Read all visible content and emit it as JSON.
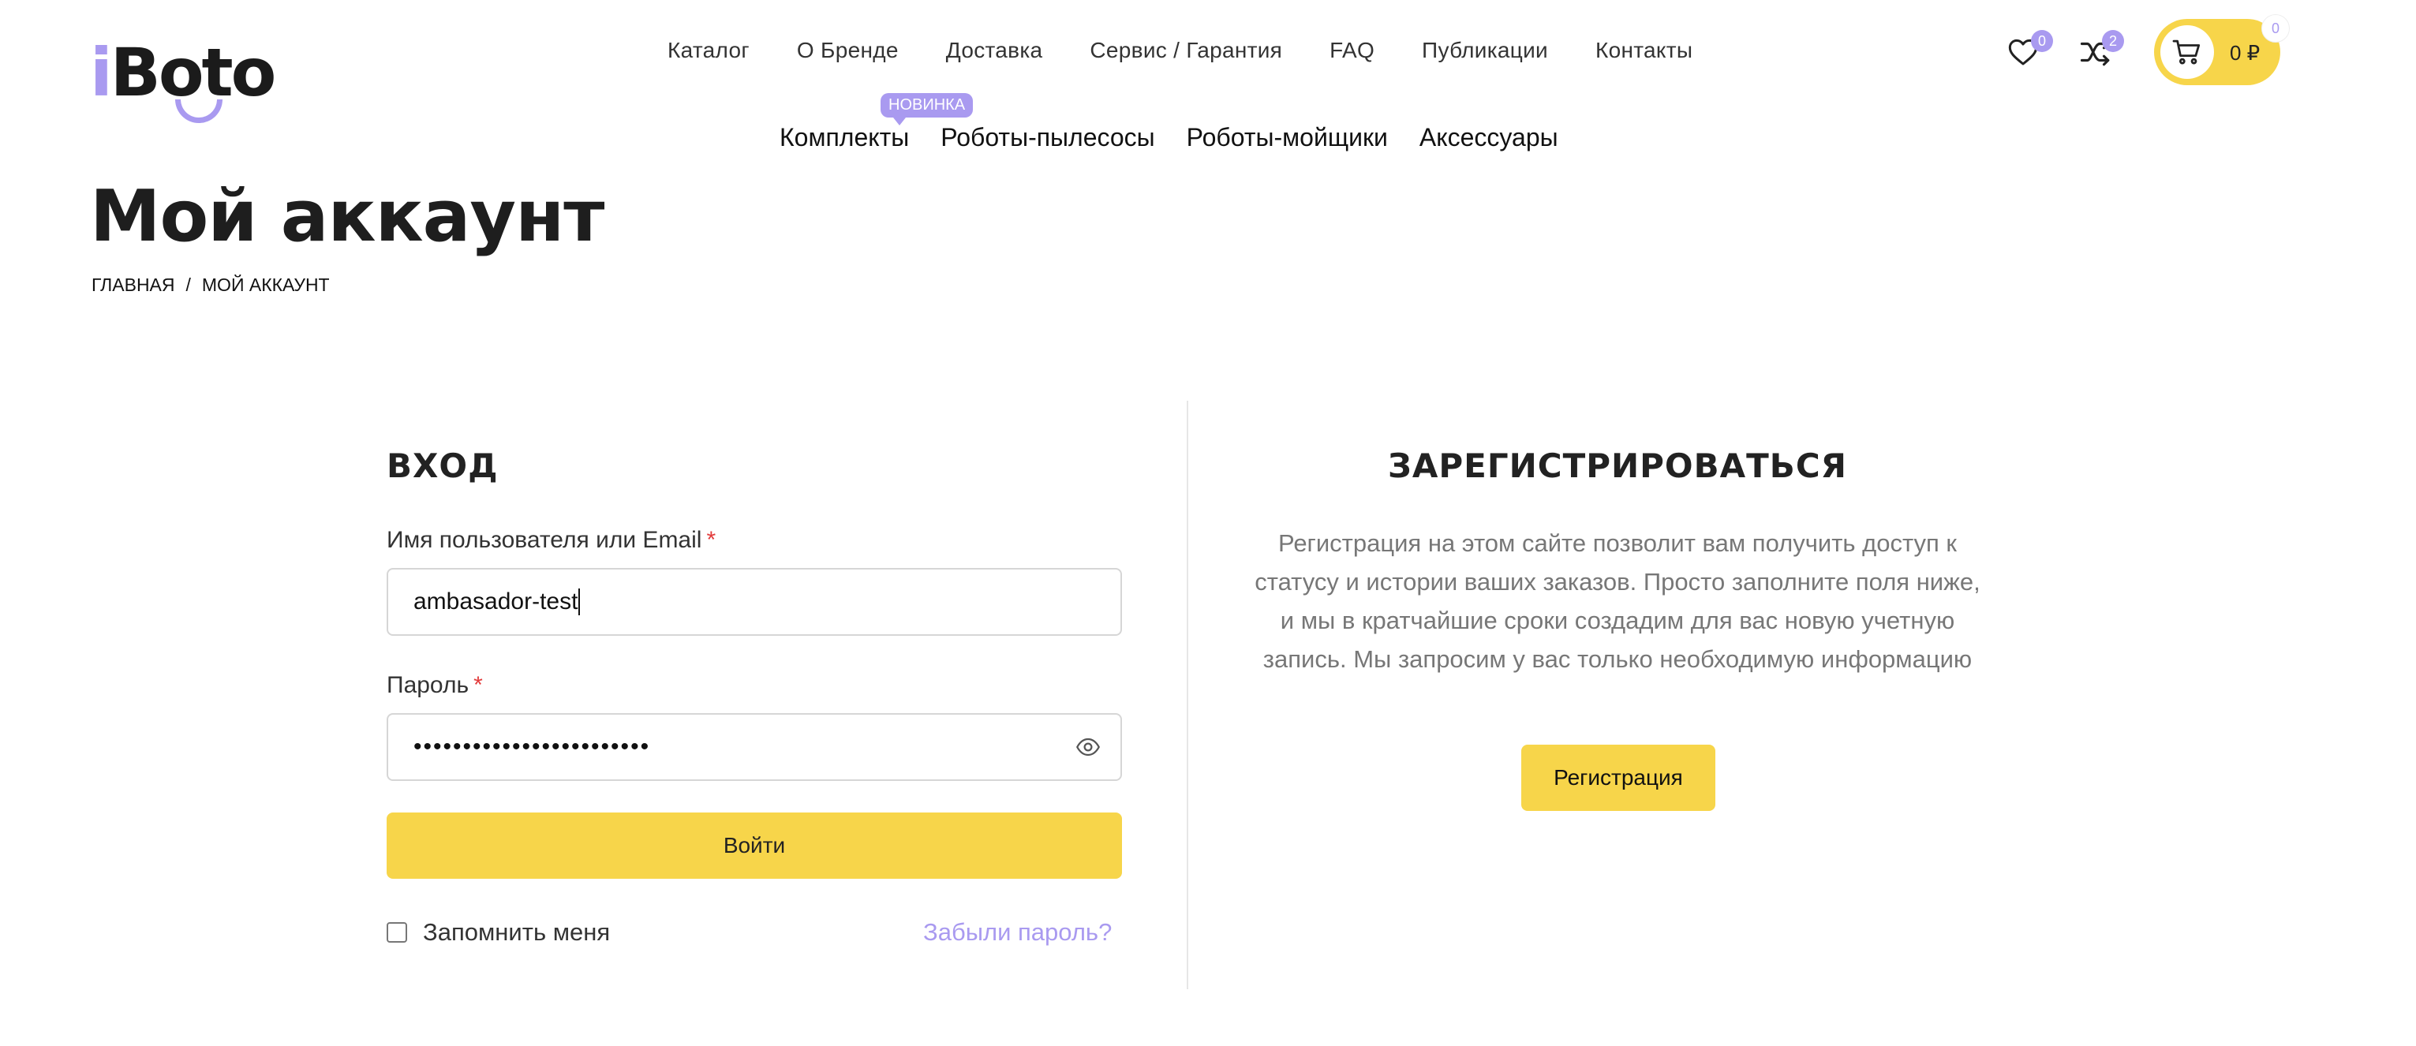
{
  "logo": {
    "i": "i",
    "rest": "Boto"
  },
  "top_nav": [
    "Каталог",
    "О Бренде",
    "Доставка",
    "Сервис / Гарантия",
    "FAQ",
    "Публикации",
    "Контакты"
  ],
  "category_nav": {
    "badge": "НОВИНКА",
    "items": [
      "Комплекты",
      "Роботы-пылесосы",
      "Роботы-мойщики",
      "Аксессуары"
    ]
  },
  "header": {
    "wishlist_count": "0",
    "compare_count": "2",
    "cart_total": "0 ₽",
    "cart_count": "0"
  },
  "page": {
    "title": "Мой аккаунт",
    "breadcrumb": [
      "Главная",
      "/",
      "Мой аккаунт"
    ]
  },
  "login": {
    "title": "ВХОД",
    "username_label": "Имя пользователя или Email",
    "required_mark": "*",
    "username_value": "ambasador-test",
    "password_label": "Пароль",
    "password_value": "••••••••••••••••••••••••",
    "submit_label": "Войти",
    "remember_label": "Запомнить меня",
    "forgot_label": "Забыли пароль?"
  },
  "register": {
    "title": "ЗАРЕГИСТРИРОВАТЬСЯ",
    "text": "Регистрация на этом сайте позволит вам получить доступ к статусу и истории ваших заказов. Просто заполните поля ниже, и мы в кратчайшие сроки создадим для вас новую учетную запись. Мы запросим у вас только необходимую информацию",
    "button_label": "Регистрация"
  },
  "colors": {
    "accent_yellow": "#f7d54a",
    "accent_purple": "#a99af0",
    "required_red": "#e23b3b"
  }
}
